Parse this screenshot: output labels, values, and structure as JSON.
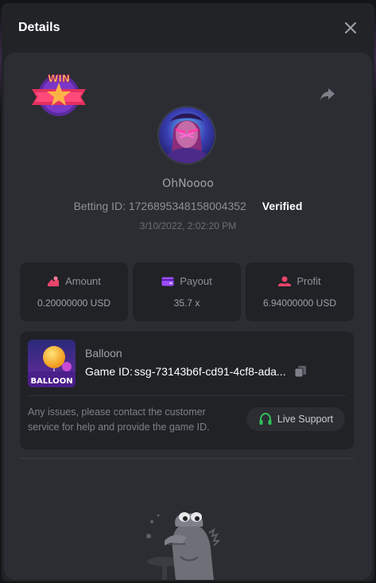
{
  "modal": {
    "title": "Details"
  },
  "icons": {
    "close": "close-icon",
    "share": "share-icon",
    "copy": "copy-icon",
    "headset": "headset-icon",
    "amount": "amount-icon",
    "payout": "payout-icon",
    "profit": "profit-icon"
  },
  "badge": {
    "text": "WIN"
  },
  "player": {
    "username": "OhNoooo",
    "betting_id_label": "Betting ID:",
    "betting_id": "1726895348158004352",
    "verified": "Verified",
    "timestamp": "3/10/2022, 2:02:20 PM"
  },
  "stats": [
    {
      "label": "Amount",
      "value": "0.20000000 USD",
      "color": "#e8456b"
    },
    {
      "label": "Payout",
      "value": "35.7 x",
      "color": "#9b4dff"
    },
    {
      "label": "Profit",
      "value": "6.94000000 USD",
      "color": "#e8456b"
    }
  ],
  "game": {
    "thumb_text": "BALLOON",
    "name": "Balloon",
    "id_label": "Game ID:",
    "id_value": "ssg-73143b6f-cd91-4cf8-ada..."
  },
  "support": {
    "text": "Any issues, please contact the customer service for help and provide the game ID.",
    "button_label": "Live Support",
    "accent": "#2fc15a"
  }
}
